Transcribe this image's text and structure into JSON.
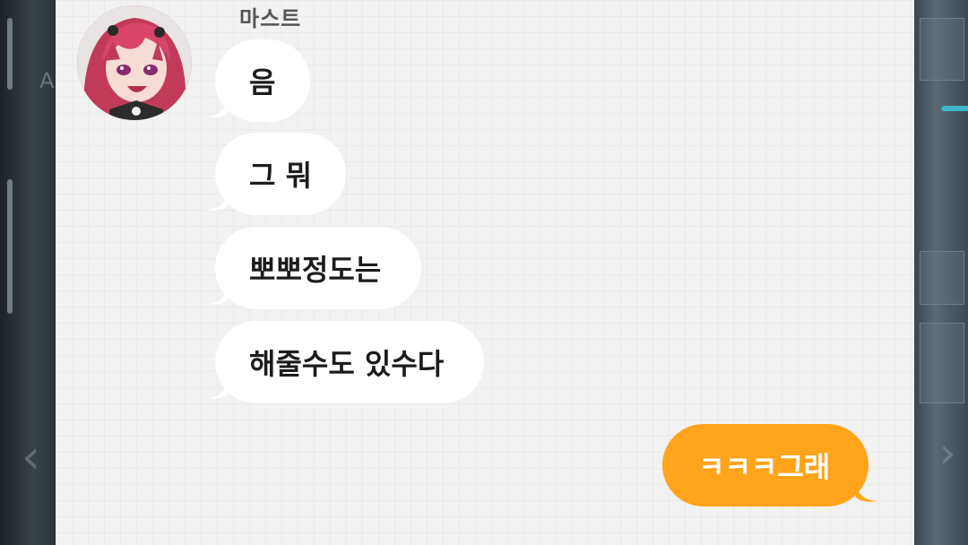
{
  "background": {
    "left_letter": "A",
    "accent_color": "#3fb6c9"
  },
  "chat": {
    "sender_name": "마스트",
    "incoming_messages": [
      "음",
      "그 뭐",
      "뽀뽀정도는",
      "해줄수도 있수다"
    ],
    "outgoing_messages": [
      "ㅋㅋㅋ그래"
    ],
    "colors": {
      "panel_bg": "#f2f2f2",
      "incoming_bubble": "#ffffff",
      "outgoing_bubble": "#ffa41b",
      "avatar_hair": "#c23a5a"
    }
  }
}
